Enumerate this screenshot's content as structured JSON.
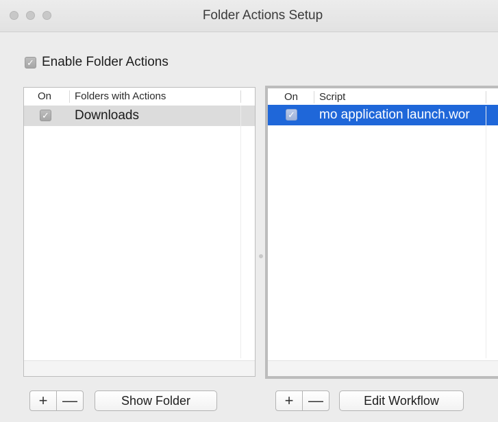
{
  "window": {
    "title": "Folder Actions Setup"
  },
  "enable": {
    "label": "Enable Folder Actions",
    "checked": true,
    "check_glyph": "✓"
  },
  "folders_table": {
    "columns": [
      "On",
      "Folders with Actions"
    ],
    "rows": [
      {
        "on": true,
        "check_glyph": "✓",
        "name": "Downloads"
      }
    ]
  },
  "scripts_table": {
    "columns": [
      "On",
      "Script"
    ],
    "rows": [
      {
        "on": true,
        "check_glyph": "✓",
        "name": "mo application launch.wor"
      }
    ],
    "selected_row_color": "#1f67d9"
  },
  "folder_buttons": {
    "add": "+",
    "remove": "—",
    "show_folder": "Show Folder"
  },
  "script_buttons": {
    "add": "+",
    "remove": "—",
    "edit_workflow": "Edit Workflow"
  }
}
